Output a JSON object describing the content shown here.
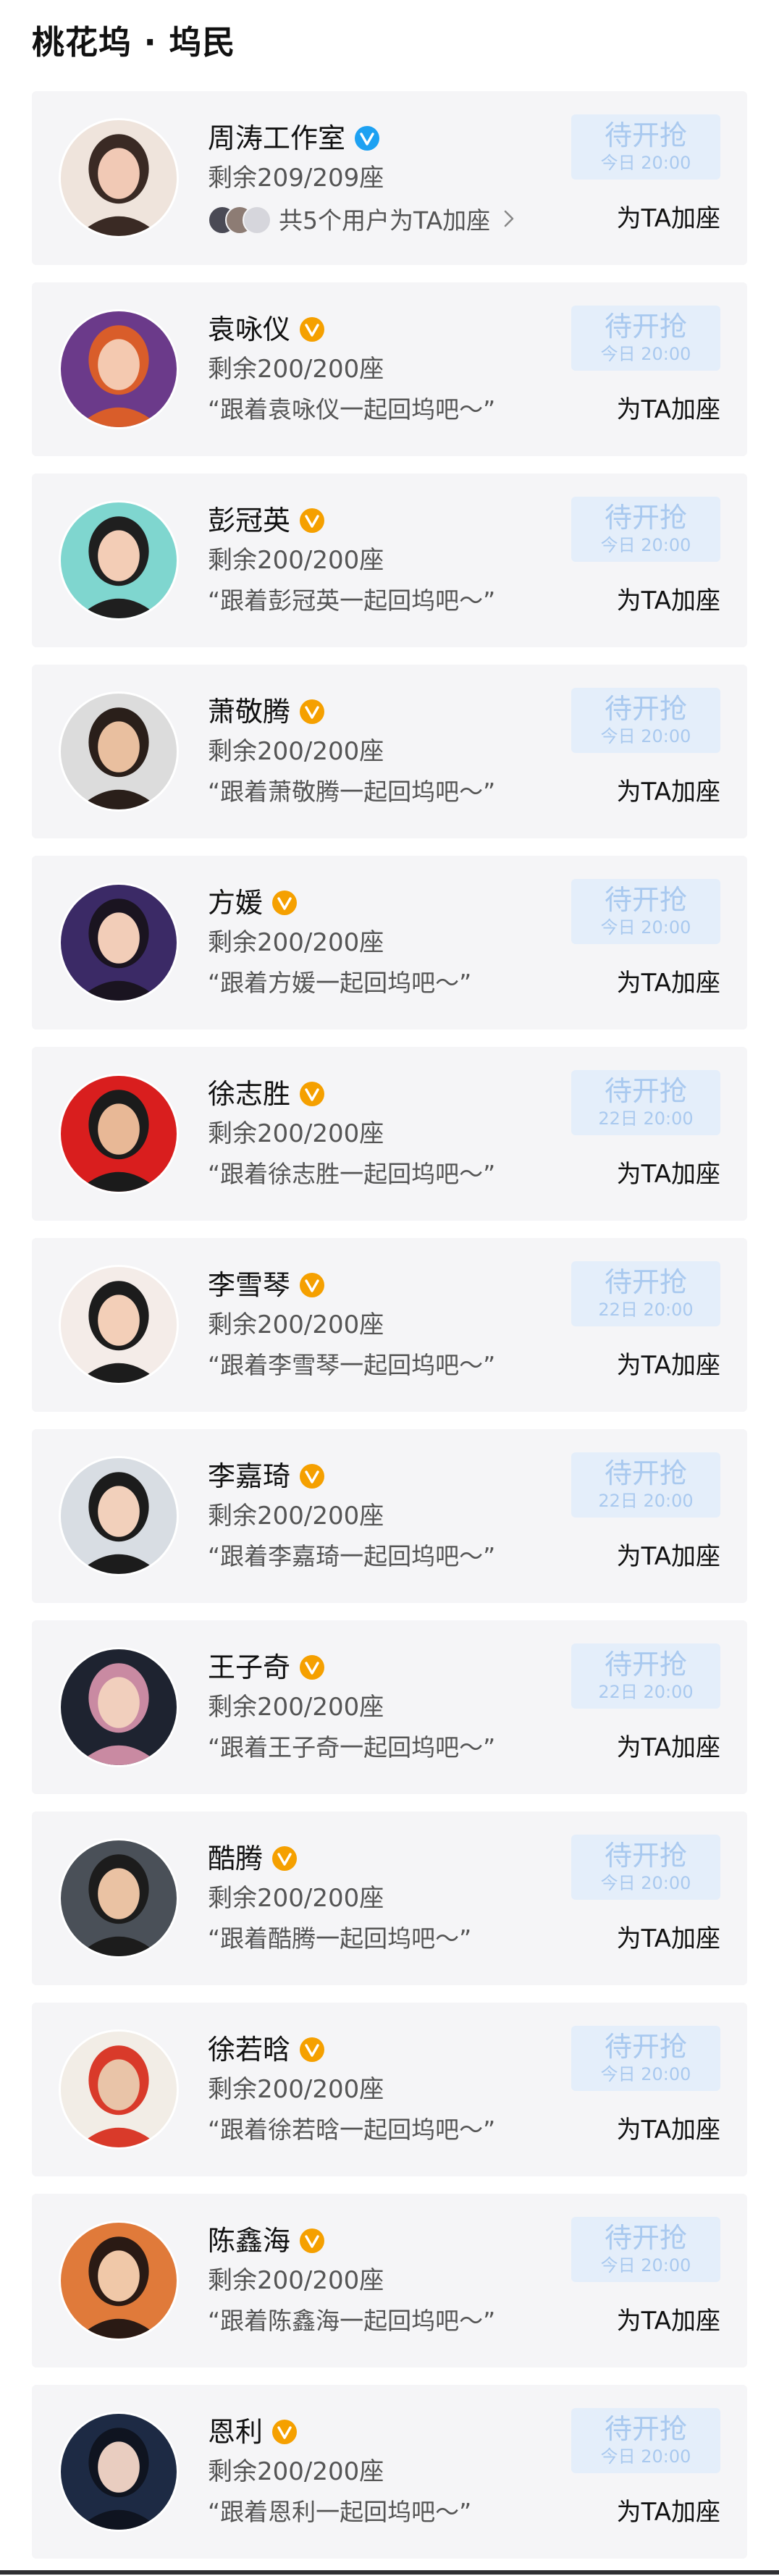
{
  "section": {
    "title": "桃花坞 · 坞民"
  },
  "add_label": "为TA加座",
  "colors": {
    "verified_blue": "#1da1f2",
    "verified_orange": "#f5a000",
    "button_bg": "#e4eefa",
    "button_text": "#a9c9ef"
  },
  "cards": [
    {
      "name": "周涛工作室",
      "badge": "verified-blue-icon",
      "remain": "剩余209/209座",
      "helpers_text": "共5个用户为TA加座",
      "button_main": "待开抢",
      "button_sub": "今日 20:00"
    },
    {
      "name": "袁咏仪",
      "badge": "verified-orange-icon",
      "remain": "剩余200/200座",
      "slogan": "“跟着袁咏仪一起回坞吧～”",
      "button_main": "待开抢",
      "button_sub": "今日 20:00"
    },
    {
      "name": "彭冠英",
      "badge": "verified-orange-icon",
      "remain": "剩余200/200座",
      "slogan": "“跟着彭冠英一起回坞吧～”",
      "button_main": "待开抢",
      "button_sub": "今日 20:00"
    },
    {
      "name": "萧敬腾",
      "badge": "verified-orange-icon",
      "remain": "剩余200/200座",
      "slogan": "“跟着萧敬腾一起回坞吧～”",
      "button_main": "待开抢",
      "button_sub": "今日 20:00"
    },
    {
      "name": "方媛",
      "badge": "verified-orange-icon",
      "remain": "剩余200/200座",
      "slogan": "“跟着方媛一起回坞吧～”",
      "button_main": "待开抢",
      "button_sub": "今日 20:00"
    },
    {
      "name": "徐志胜",
      "badge": "verified-orange-icon",
      "remain": "剩余200/200座",
      "slogan": "“跟着徐志胜一起回坞吧～”",
      "button_main": "待开抢",
      "button_sub": "22日 20:00"
    },
    {
      "name": "李雪琴",
      "badge": "verified-orange-icon",
      "remain": "剩余200/200座",
      "slogan": "“跟着李雪琴一起回坞吧～”",
      "button_main": "待开抢",
      "button_sub": "22日 20:00"
    },
    {
      "name": "李嘉琦",
      "badge": "verified-orange-icon",
      "remain": "剩余200/200座",
      "slogan": "“跟着李嘉琦一起回坞吧～”",
      "button_main": "待开抢",
      "button_sub": "22日 20:00"
    },
    {
      "name": "王子奇",
      "badge": "verified-orange-icon",
      "remain": "剩余200/200座",
      "slogan": "“跟着王子奇一起回坞吧～”",
      "button_main": "待开抢",
      "button_sub": "22日 20:00"
    },
    {
      "name": "酷腾",
      "badge": "verified-orange-icon",
      "remain": "剩余200/200座",
      "slogan": "“跟着酷腾一起回坞吧～”",
      "button_main": "待开抢",
      "button_sub": "今日 20:00"
    },
    {
      "name": "徐若晗",
      "badge": "verified-orange-icon",
      "remain": "剩余200/200座",
      "slogan": "“跟着徐若晗一起回坞吧～”",
      "button_main": "待开抢",
      "button_sub": "今日 20:00"
    },
    {
      "name": "陈鑫海",
      "badge": "verified-orange-icon",
      "remain": "剩余200/200座",
      "slogan": "“跟着陈鑫海一起回坞吧～”",
      "button_main": "待开抢",
      "button_sub": "今日 20:00"
    },
    {
      "name": "恩利",
      "badge": "verified-orange-icon",
      "remain": "剩余200/200座",
      "slogan": "“跟着恩利一起回坞吧～”",
      "button_main": "待开抢",
      "button_sub": "今日 20:00"
    }
  ]
}
